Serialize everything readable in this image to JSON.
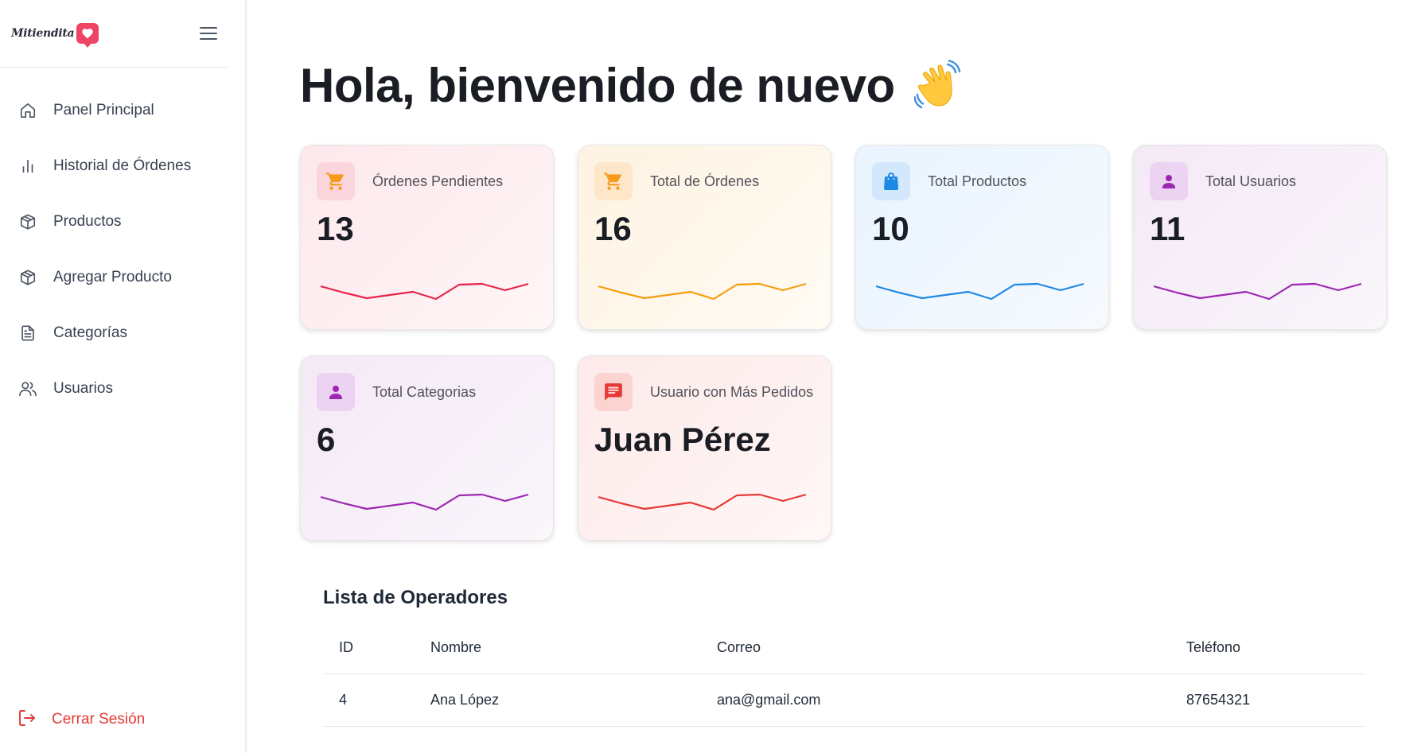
{
  "brand": {
    "logo_text": "Mitiendita"
  },
  "sidebar": {
    "items": [
      {
        "label": "Panel Principal",
        "icon": "home-icon"
      },
      {
        "label": "Historial de Órdenes",
        "icon": "bar-chart-icon"
      },
      {
        "label": "Productos",
        "icon": "box-icon"
      },
      {
        "label": "Agregar Producto",
        "icon": "box-icon"
      },
      {
        "label": "Categorías",
        "icon": "document-icon"
      },
      {
        "label": "Usuarios",
        "icon": "users-icon"
      }
    ],
    "logout_label": "Cerrar Sesión"
  },
  "main": {
    "title": "Hola, bienvenido de nuevo",
    "cards": [
      {
        "label": "Órdenes Pendientes",
        "value": "13",
        "icon": "cart-icon",
        "color": "#e8244a",
        "accent": "#f79a1e"
      },
      {
        "label": "Total de Órdenes",
        "value": "16",
        "icon": "cart-icon",
        "color": "#f59e0b",
        "accent": "#f79a1e"
      },
      {
        "label": "Total Productos",
        "value": "10",
        "icon": "shopping-bag-icon",
        "color": "#1e88e5",
        "accent": "#1e88e5"
      },
      {
        "label": "Total Usuarios",
        "value": "11",
        "icon": "person-icon",
        "color": "#9c27b0",
        "accent": "#9c27b0"
      },
      {
        "label": "Total Categorias",
        "value": "6",
        "icon": "person-icon",
        "color": "#9c27b0",
        "accent": "#9c27b0"
      },
      {
        "label": "Usuario con Más Pedidos",
        "value": "Juan Pérez",
        "icon": "message-icon",
        "color": "#e53935",
        "accent": "#e53935"
      }
    ],
    "operators": {
      "title": "Lista de Operadores",
      "columns": [
        "ID",
        "Nombre",
        "Correo",
        "Teléfono"
      ],
      "rows": [
        [
          "4",
          "Ana López",
          "ana@gmail.com",
          "87654321"
        ]
      ]
    }
  },
  "colors": {
    "logout": "#e53935",
    "brand_heart": "#ef4565"
  }
}
